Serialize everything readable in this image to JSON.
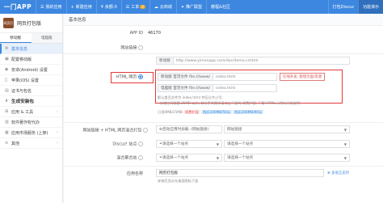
{
  "topbar": {
    "brand": "一门APP",
    "nav": [
      {
        "icon": "☰",
        "label": "我的应用"
      },
      {
        "icon": "+",
        "label": "新建应用"
      },
      {
        "icon": "¥",
        "label": "余额:0"
      },
      {
        "icon": "☰",
        "label": "工单",
        "badge": "0"
      },
      {
        "icon": "☁",
        "label": "云商城"
      },
      {
        "icon": "✦",
        "label": "推广联盟"
      },
      {
        "icon": "",
        "label": "教程&社区"
      }
    ],
    "right": [
      {
        "label": "打包Discuz"
      },
      {
        "label": "功能演示"
      }
    ]
  },
  "sidebar": {
    "app_logo_text": "网页打",
    "app_name": "网页打包版",
    "tabs": [
      "移动版",
      "电脑版"
    ],
    "menu": [
      {
        "label": "基本信息",
        "icon": "⚙",
        "active": true
      },
      {
        "label": "配置移动版",
        "icon": "▣"
      },
      {
        "label": "安卓(Android) 设置",
        "icon": "◉"
      },
      {
        "label": "苹果(iOS) 设置",
        "icon": ""
      },
      {
        "label": "证书与包名",
        "icon": "▤"
      },
      {
        "label": "生成安装包",
        "icon": "",
        "group": true
      },
      {
        "label": "应用 & 工具",
        "icon": "⊞",
        "arrow": "›"
      },
      {
        "label": "软件著作权代办",
        "icon": "▥"
      },
      {
        "label": "应用市场服务 (上架)",
        "icon": "▦",
        "arrow": "›"
      },
      {
        "label": "其他",
        "icon": "≡",
        "arrow": "›"
      }
    ]
  },
  "main": {
    "section_title": "基本信息",
    "app_id_label": "APP ID",
    "app_id_value": "46170",
    "web_link_label": "网站链接",
    "web_link_tag": "移动版",
    "web_link_value": "http://www.yimenapp.com/doc/demo.cshtml",
    "html_label": "HTML 网页",
    "html_tag": "移动版 首页文件 file:///www/",
    "html_value": "index.html",
    "html_btn": "在线开发, 管理页面/资源",
    "html_tag2": "电脑版 首页文件 file:///www/",
    "html_value2": "index.html",
    "html_hint1": "默认首页文件为 index.html 并区分大小写;",
    "html_hint2": "· 存储空间限额 25MB 以内, 如有更大需求请点击下面的 续费扩容, 下载 HTML 示例与开发说明",
    "html_quota1": "已用0MB/25MB",
    "html_quota2": "续费扩容",
    "html_quota3": "购买100MB/50元",
    "html_quota4": "购买200MB/90元",
    "mix_label": "网站链接 + HTML 网页混合打包",
    "mix_value": "启动应用时加载: (网站链接)",
    "mix_select": "网站链接",
    "discuz_label": "Discuz! 站点",
    "discuz_value": "请选择一个站点",
    "discuz_select": "请选择一个站点",
    "mix2_label": "混合聚合站",
    "mix2_value": "请选择一个站点",
    "mix2_select": "请选择一个站点",
    "name_label": "应用名称",
    "name_value": "网页打包版",
    "name_plus": "多语言支持",
    "name_hint": "安装后显示在桌面图标下面"
  }
}
